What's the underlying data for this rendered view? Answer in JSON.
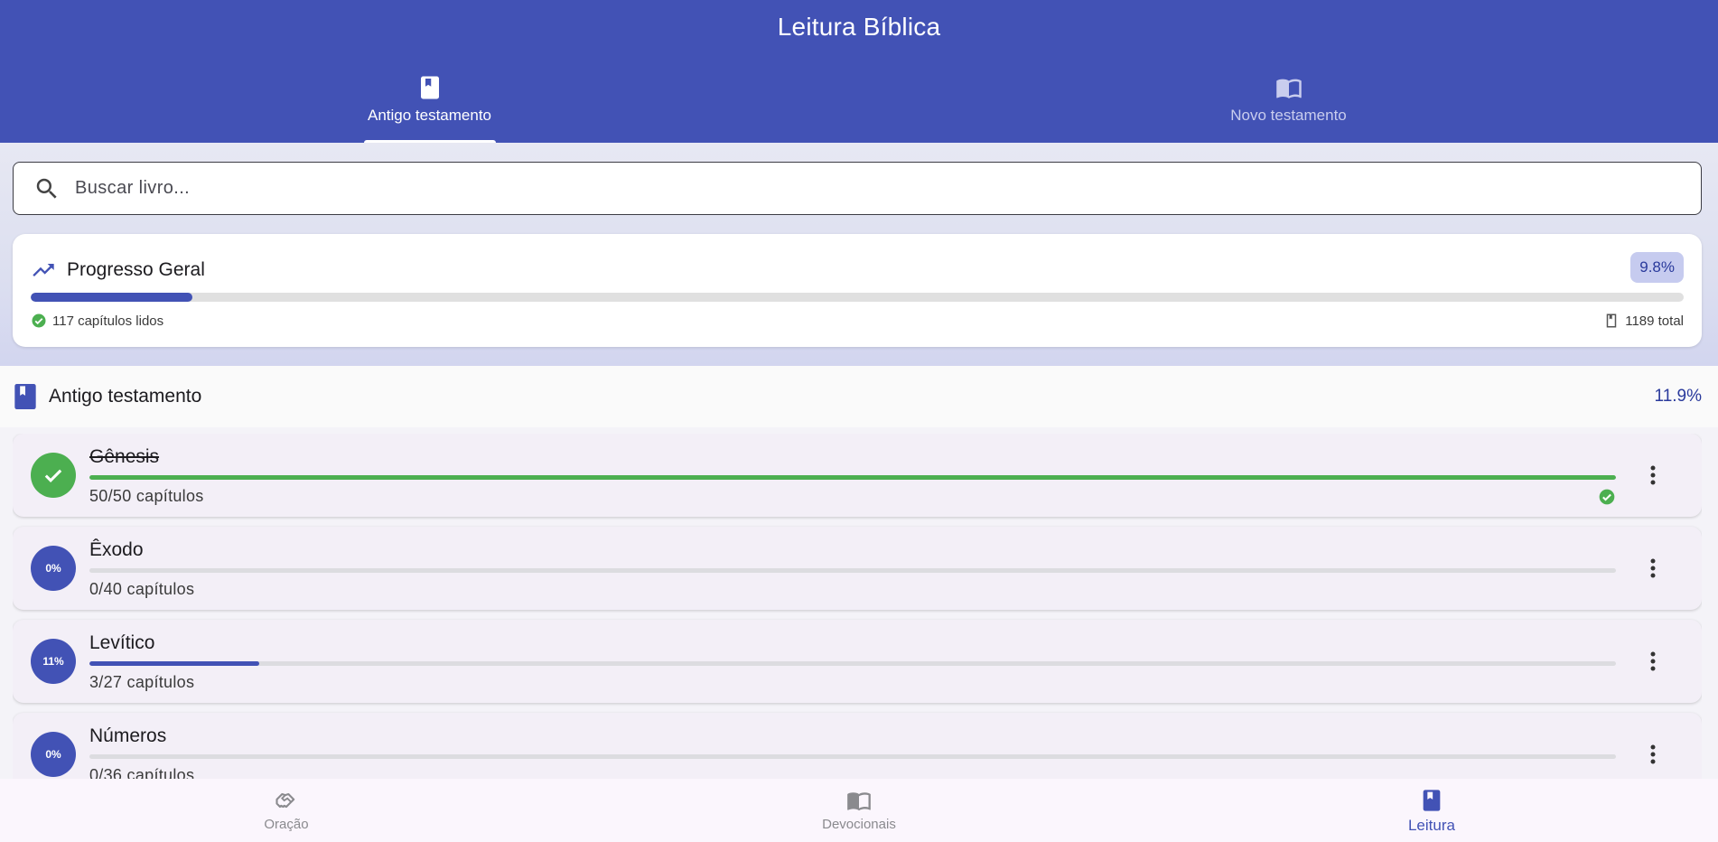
{
  "appbar": {
    "title": "Leitura Bíblica",
    "tabs": [
      {
        "label": "Antigo testamento",
        "icon": "book-icon",
        "active": true
      },
      {
        "label": "Novo testamento",
        "icon": "open-book-icon",
        "active": false
      }
    ]
  },
  "search": {
    "placeholder": "Buscar livro..."
  },
  "overall": {
    "title": "Progresso Geral",
    "percent": "9.8%",
    "progress": 0.098,
    "read_label": "117 capítulos lidos",
    "total_label": "1189 total"
  },
  "section": {
    "title": "Antigo testamento",
    "percent": "11.9%"
  },
  "books": [
    {
      "name": "Gênesis",
      "chapters": "50/50 capítulos",
      "badge": "",
      "progress": 1.0,
      "complete": true
    },
    {
      "name": "Êxodo",
      "chapters": "0/40 capítulos",
      "badge": "0%",
      "progress": 0.0,
      "complete": false
    },
    {
      "name": "Levítico",
      "chapters": "3/27 capítulos",
      "badge": "11%",
      "progress": 0.111,
      "complete": false
    },
    {
      "name": "Números",
      "chapters": "0/36 capítulos",
      "badge": "0%",
      "progress": 0.0,
      "complete": false
    }
  ],
  "bottom_nav": [
    {
      "label": "Oração",
      "icon": "handshake-icon",
      "active": false
    },
    {
      "label": "Devocionais",
      "icon": "open-book-icon",
      "active": false
    },
    {
      "label": "Leitura",
      "icon": "book-icon",
      "active": true
    }
  ],
  "colors": {
    "primary": "#4252b5",
    "success": "#4caf50",
    "badge_bg": "#c6cbef"
  }
}
